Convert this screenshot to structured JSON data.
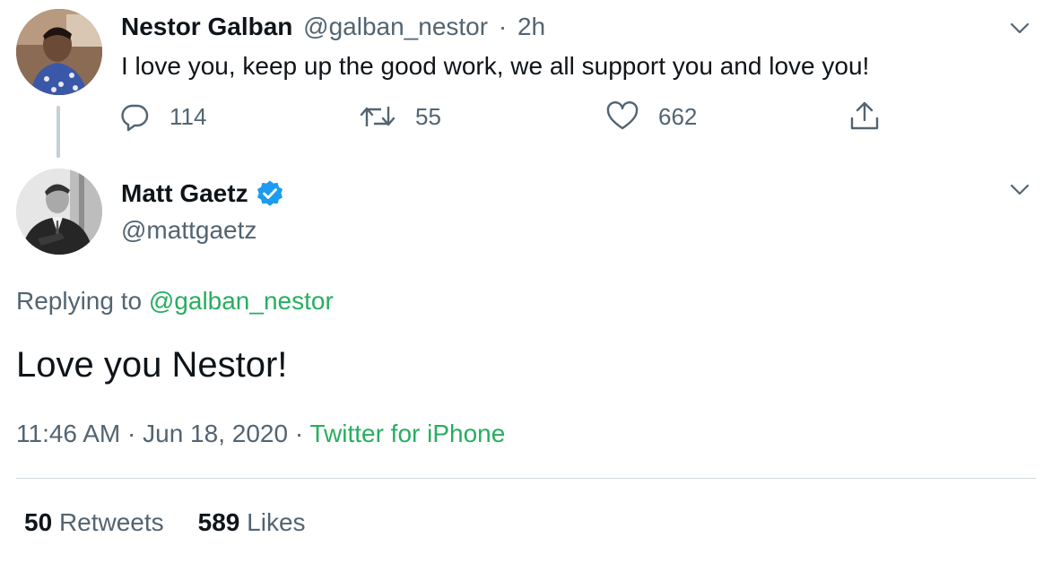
{
  "parent_tweet": {
    "author_name": "Nestor Galban",
    "author_handle": "@galban_nestor",
    "separator": "·",
    "time_ago": "2h",
    "text": "I love you, keep up the good work, we all support you and love you!",
    "reply_count": "114",
    "retweet_count": "55",
    "like_count": "662",
    "icons": {
      "reply": "reply-icon",
      "retweet": "retweet-icon",
      "like": "like-icon",
      "share": "share-icon",
      "menu": "chevron-down-icon"
    }
  },
  "main_tweet": {
    "author_name": "Matt Gaetz",
    "author_handle": "@mattgaetz",
    "verified": true,
    "replying_prefix": "Replying to",
    "replying_to": "@galban_nestor",
    "text": "Love you Nestor!",
    "time": "11:46 AM",
    "separator": "·",
    "date": "Jun 18, 2020",
    "source": "Twitter for iPhone",
    "retweets_count": "50",
    "retweets_label": "Retweets",
    "likes_count": "589",
    "likes_label": "Likes"
  },
  "colors": {
    "text_primary": "#0f1419",
    "text_secondary": "#536471",
    "link": "#27ae60",
    "verified": "#1d9bf0",
    "divider": "#cfd9de"
  }
}
